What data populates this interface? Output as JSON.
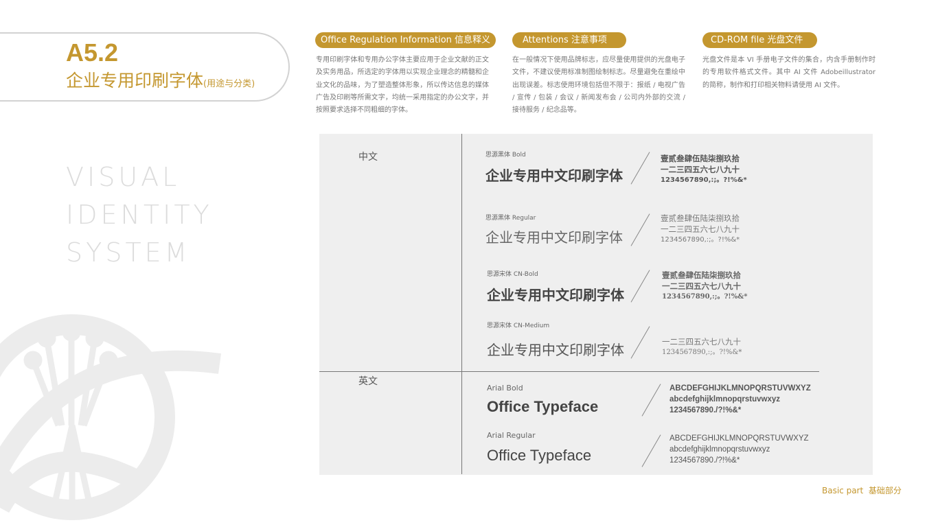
{
  "header": {
    "code": "A5.2",
    "title": "企业专用印刷字体",
    "title_note": "(用途与分类)"
  },
  "watermark": [
    "VISUAL",
    "IDENTITY",
    "SYSTEM"
  ],
  "sections": [
    {
      "title": "Office Regulation Information 信息释义",
      "text": "专用印刷字体和专用办公字体主要应用于企业文献的正文及实务用品，所选定的字体用以实现企业理念的精髓和企业文化的品味，为了塑造整体形象，所以传达信息的媒体广告及印刷等所需文字，均统一采用指定的办公文字，并按照要求选择不同粗细的字体。"
    },
    {
      "title": "Attentions 注意事项",
      "text": "在一般情况下使用品牌标志，应尽量使用提供的光盘电子文件，不建议使用标准制图绘制标志。尽量避免在重绘中出现误差。标志使用环境包括但不限于：报纸 / 电视广告 / 宣传 / 包装 / 会议 / 新闻发布会 / 公司内外部的交流 / 接待服务 / 纪念品等。"
    },
    {
      "title": "CD-ROM file 光盘文件",
      "text": "光盘文件是本 VI 手册电子文件的集合，内含手册制作时的专用软件格式文件。其中 AI 文件 Adobeillustrator 的简称，制作和打印相关物料请使用 AI 文件。"
    }
  ],
  "panel": {
    "chinese_label": "中文",
    "english_label": "英文",
    "chinese": [
      {
        "font": "思源黑体 Bold",
        "sample": "企业专用中文印刷字体",
        "lines": [
          "壹贰叁肆伍陆柒捌玖拾",
          "一二三四五六七八九十",
          "1234567890,:;。?!%&*"
        ]
      },
      {
        "font": "思源黑体 Regular",
        "sample": "企业专用中文印刷字体",
        "lines": [
          "壹贰叁肆伍陆柒捌玖拾",
          "一二三四五六七八九十",
          "1234567890,:;。?!%&*"
        ]
      },
      {
        "font": "思源宋体 CN-Bold",
        "sample": "企业专用中文印刷字体",
        "lines": [
          "壹贰叁肆伍陆柒捌玖拾",
          "一二三四五六七八九十",
          "1234567890,:;。?!%&*"
        ]
      },
      {
        "font": "思源宋体 CN-Medium",
        "sample": "企业专用中文印刷字体",
        "lines": [
          "一二三四五六七八九十",
          "1234567890,:;。?!%&*"
        ]
      }
    ],
    "english": [
      {
        "font": "Arial Bold",
        "sample": "Office Typeface",
        "lines": [
          "ABCDEFGHIJKLMNOPQRSTUVWXYZ",
          "abcdefghijklmnopqrstuvwxyz",
          "1234567890./?!%&*"
        ]
      },
      {
        "font": "Arial Regular",
        "sample": "Office Typeface",
        "lines": [
          "ABCDEFGHIJKLMNOPQRSTUVWXYZ",
          "abcdefghijklmnopqrstuvwxyz",
          "1234567890./?!%&*"
        ]
      }
    ]
  },
  "footer": "Basic part  基础部分",
  "colors": {
    "accent": "#c4972f",
    "panel": "#efefef"
  }
}
